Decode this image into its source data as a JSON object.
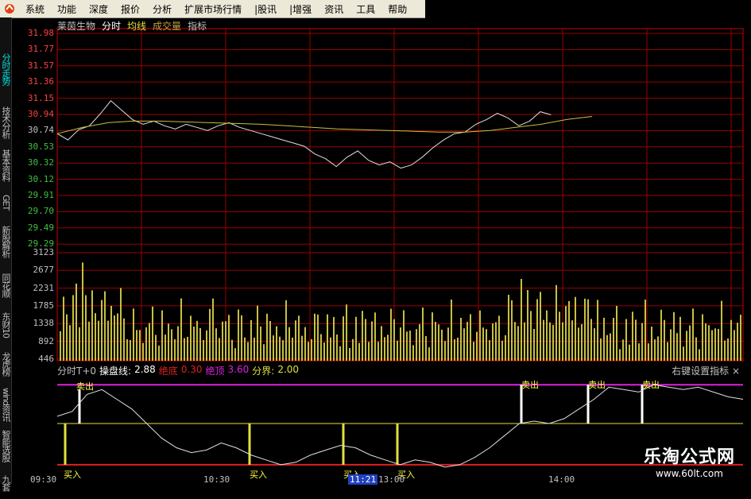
{
  "menu": {
    "items": [
      "系统",
      "功能",
      "深度",
      "报价",
      "分析",
      "扩展市场行情",
      "|股讯",
      "|增强",
      "资讯",
      "工具",
      "帮助"
    ]
  },
  "sidebar": {
    "tabs": [
      "分时走势",
      "技术分析",
      "基本资料",
      "GET",
      "新股解析",
      "同花顺",
      "东财10",
      "龙虎榜",
      "wind资讯",
      "智能选股",
      "九套"
    ]
  },
  "header": {
    "stock": "莱茵生物",
    "tab_fenshi": "分时",
    "tab_junxian": "均线",
    "tab_volume": "成交量",
    "tab_indicator": "指标"
  },
  "price_axis": [
    "31.98",
    "31.77",
    "31.57",
    "31.36",
    "31.15",
    "30.94",
    "30.74",
    "30.53",
    "30.32",
    "30.12",
    "29.91",
    "29.70",
    "29.49",
    "29.29"
  ],
  "volume_axis": [
    "3123",
    "2677",
    "2231",
    "1785",
    "1338",
    "892",
    "446"
  ],
  "indicator_bar": {
    "name": "分时T+0",
    "l1_label": "操盘线:",
    "l1_value": "2.88",
    "l2_label": "绝底",
    "l2_value": "0.30",
    "l3_label": "绝顶",
    "l3_value": "3.60",
    "l4_label": "分界:",
    "l4_value": "2.00"
  },
  "indicator_right": "右键设置指标 ×",
  "signals": {
    "sell": "卖出",
    "buy": "买入"
  },
  "times": {
    "t1": "09:30",
    "t2": "10:30",
    "t3": "11:21",
    "t4": "13:00",
    "t5": "14:00"
  },
  "watermark": {
    "line1": "乐淘公式网",
    "line2": "www.60lt.com"
  },
  "chart_data": {
    "type": "line",
    "price_ylim": [
      29.29,
      31.98
    ],
    "price": [
      30.7,
      30.62,
      30.75,
      30.8,
      30.95,
      31.12,
      31.0,
      30.88,
      30.82,
      30.86,
      30.8,
      30.76,
      30.82,
      30.78,
      30.74,
      30.8,
      30.84,
      30.78,
      30.74,
      30.7,
      30.66,
      30.62,
      30.58,
      30.54,
      30.44,
      30.38,
      30.28,
      30.4,
      30.48,
      30.36,
      30.3,
      30.34,
      30.26,
      30.3,
      30.4,
      30.52,
      30.62,
      30.7,
      30.72,
      30.82,
      30.88,
      30.96,
      30.9,
      30.8,
      30.86,
      30.98,
      30.94
    ],
    "avg": [
      30.7,
      30.78,
      30.84,
      30.86,
      30.86,
      30.85,
      30.84,
      30.83,
      30.82,
      30.8,
      30.78,
      30.76,
      30.75,
      30.74,
      30.73,
      30.72,
      30.72,
      30.74,
      30.78,
      30.82,
      30.88,
      30.92
    ],
    "volume_ylim": [
      0,
      3300
    ],
    "indicator_ylim": [
      0,
      4
    ],
    "indicator": [
      2.3,
      2.5,
      3.2,
      3.4,
      3.0,
      2.6,
      2.0,
      1.4,
      1.0,
      0.8,
      0.9,
      1.2,
      1.0,
      0.7,
      0.5,
      0.3,
      0.4,
      0.7,
      0.9,
      1.1,
      1.0,
      0.7,
      0.5,
      0.3,
      0.5,
      0.4,
      0.2,
      0.3,
      0.6,
      1.0,
      1.5,
      2.0,
      2.1,
      2.0,
      2.2,
      2.6,
      3.0,
      3.5,
      3.4,
      3.3,
      3.6,
      3.5,
      3.4,
      3.5,
      3.3,
      3.1,
      3.0
    ]
  }
}
